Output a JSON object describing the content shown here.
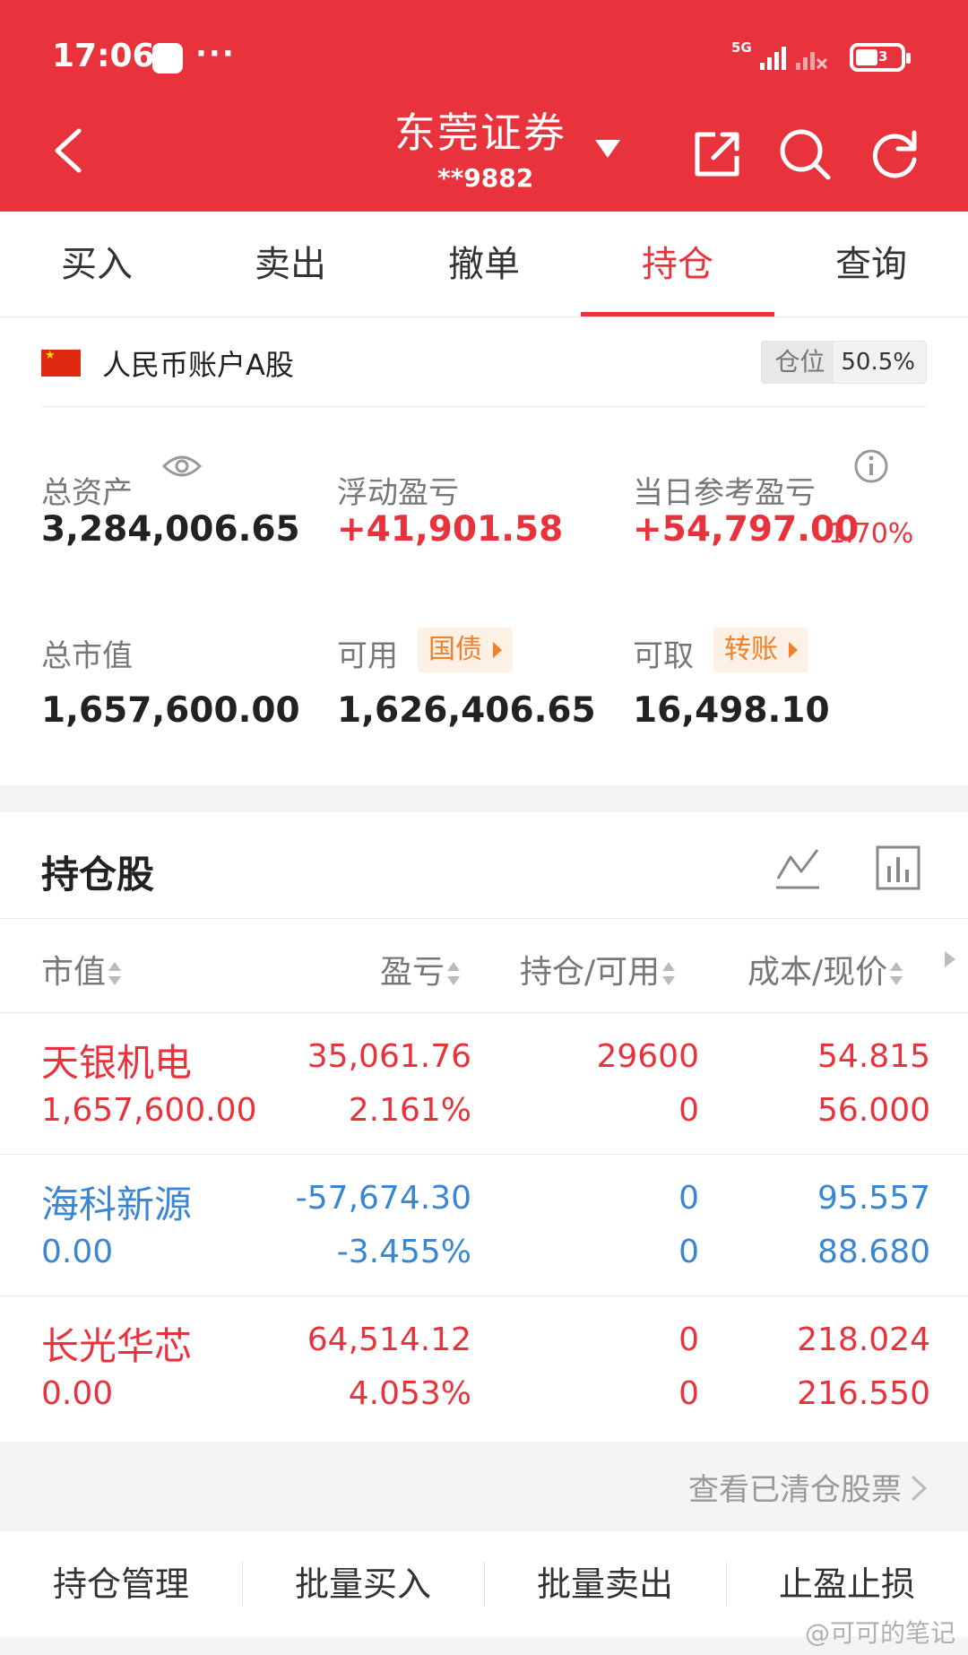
{
  "status_bar": {
    "time": "17:06",
    "dots": "···",
    "network": "5G",
    "battery_level": "3"
  },
  "header": {
    "title": "东莞证券",
    "account": "**9882"
  },
  "tabs": [
    {
      "label": "买入"
    },
    {
      "label": "卖出"
    },
    {
      "label": "撤单"
    },
    {
      "label": "持仓",
      "active": true
    },
    {
      "label": "查询"
    }
  ],
  "account": {
    "label": "人民币账户A股",
    "position_label": "仓位",
    "position_value": "50.5%"
  },
  "metrics": {
    "total_assets_label": "总资产",
    "total_assets": "3,284,006.65",
    "float_pl_label": "浮动盈亏",
    "float_pl": "+41,901.58",
    "daily_pl_label": "当日参考盈亏",
    "daily_pl": "+54,797.00",
    "daily_pl_pct": "1.70%",
    "market_value_label": "总市值",
    "market_value": "1,657,600.00",
    "available_label": "可用",
    "available_tag": "国债",
    "available": "1,626,406.65",
    "withdrawable_label": "可取",
    "withdrawable_tag": "转账",
    "withdrawable": "16,498.10"
  },
  "holdings": {
    "title": "持仓股",
    "columns": [
      "市值",
      "盈亏",
      "持仓/可用",
      "成本/现价"
    ],
    "rows": [
      {
        "name": "天银机电",
        "market_value": "1,657,600.00",
        "pl": "35,061.76",
        "pl_pct": "2.161%",
        "position": "29600",
        "available": "0",
        "cost": "54.815",
        "price": "56.000",
        "color": "red"
      },
      {
        "name": "海科新源",
        "market_value": "0.00",
        "pl": "-57,674.30",
        "pl_pct": "-3.455%",
        "position": "0",
        "available": "0",
        "cost": "95.557",
        "price": "88.680",
        "color": "blue"
      },
      {
        "name": "长光华芯",
        "market_value": "0.00",
        "pl": "64,514.12",
        "pl_pct": "4.053%",
        "position": "0",
        "available": "0",
        "cost": "218.024",
        "price": "216.550",
        "color": "red"
      }
    ]
  },
  "view_cleared": "查看已清仓股票",
  "bottom_actions": [
    {
      "label": "持仓管理"
    },
    {
      "label": "批量买入"
    },
    {
      "label": "批量卖出"
    },
    {
      "label": "止盈止损"
    }
  ],
  "watermark": "@可可的笔记",
  "colors": {
    "brand": "#e8323c",
    "up": "#e8323c",
    "down": "#3a86d3",
    "accent_tag": "#f0802c"
  }
}
